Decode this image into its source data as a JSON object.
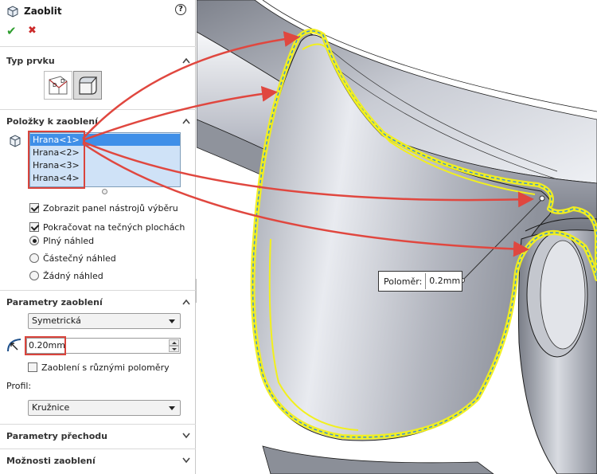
{
  "panel": {
    "title": "Zaoblit",
    "help": "?",
    "ok": "✔",
    "cancel": "✖",
    "type_section": {
      "title": "Typ prvku",
      "buttons": [
        "fillet-constant-icon",
        "fillet-face-icon"
      ]
    },
    "items_section": {
      "title": "Položky k zaoblení",
      "edges": [
        "Hrana<1>",
        "Hrana<2>",
        "Hrana<3>",
        "Hrana<4>"
      ],
      "show_toolbar": "Zobrazit panel nástrojů výběru",
      "tangent": "Pokračovat na tečných plochách",
      "preview_full": "Plný náhled",
      "preview_partial": "Částečný náhled",
      "preview_none": "Žádný náhled"
    },
    "params_section": {
      "title": "Parametry zaoblení",
      "method": "Symetrická",
      "radius": "0.20mm",
      "multi_radius": "Zaoblení s různými poloměry",
      "profile_label": "Profil:",
      "profile": "Kružnice"
    },
    "transition_section": {
      "title": "Parametry přechodu"
    },
    "options_section": {
      "title": "Možnosti zaoblení"
    }
  },
  "viewport": {
    "callout_label": "Poloměr:",
    "callout_value": "0.2mm",
    "highlight_color": "#f2f01c",
    "arrow_color": "#e0473f"
  }
}
